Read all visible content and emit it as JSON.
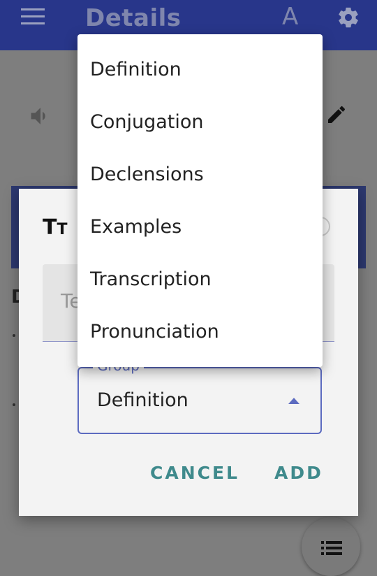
{
  "appbar": {
    "title": "Details",
    "font_button": "A"
  },
  "dialog": {
    "text_field_label": "Te",
    "group": {
      "label": "Group",
      "value": "Definition"
    },
    "cancel_label": "CANCEL",
    "add_label": "ADD"
  },
  "background": {
    "section_letter": "D"
  },
  "menu": {
    "items": [
      {
        "label": "Definition"
      },
      {
        "label": "Conjugation"
      },
      {
        "label": "Declensions"
      },
      {
        "label": "Examples"
      },
      {
        "label": "Transcription"
      },
      {
        "label": "Pronunciation"
      }
    ]
  },
  "colors": {
    "accent": "#5c6bc0",
    "button_text": "#3f8a8c",
    "appbar": "#3f51b5"
  },
  "icons": [
    "menu-icon",
    "gear-icon",
    "volume-icon",
    "pencil-icon",
    "text-size-icon",
    "clear-icon",
    "dropdown-arrow-icon",
    "list-icon"
  ]
}
